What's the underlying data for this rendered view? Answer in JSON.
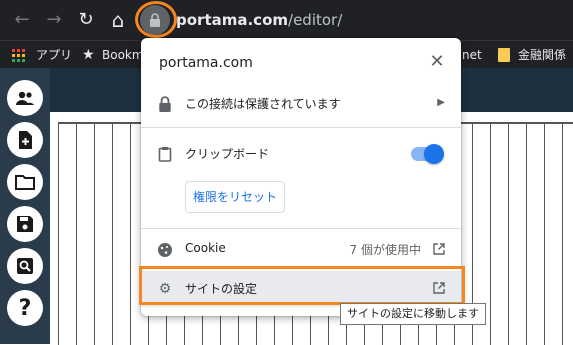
{
  "browser": {
    "back_icon": "←",
    "forward_icon": "→",
    "reload_icon": "↻",
    "home_icon": "⌂",
    "url_host": "portama.com",
    "url_path": "/editor/",
    "url_prefix_hidden": "p"
  },
  "bookmarks": {
    "apps_label": "アプリ",
    "item1": "Bookm",
    "item2": "net",
    "item3": "金融関係"
  },
  "popup": {
    "site": "portama.com",
    "close_icon": "✕",
    "connection_label": "この接続は保護されています",
    "clipboard_label": "クリップボード",
    "clipboard_enabled": true,
    "reset_label": "権限をリセット",
    "cookie_label": "Cookie",
    "cookie_status": "7 個が使用中",
    "site_settings_label": "サイトの設定",
    "tooltip": "サイトの設定に移動します"
  },
  "colors": {
    "highlight": "#f6861f",
    "accent": "#1a73e8",
    "chrome_bg": "#202124"
  },
  "rail": {
    "help_label": "?"
  }
}
